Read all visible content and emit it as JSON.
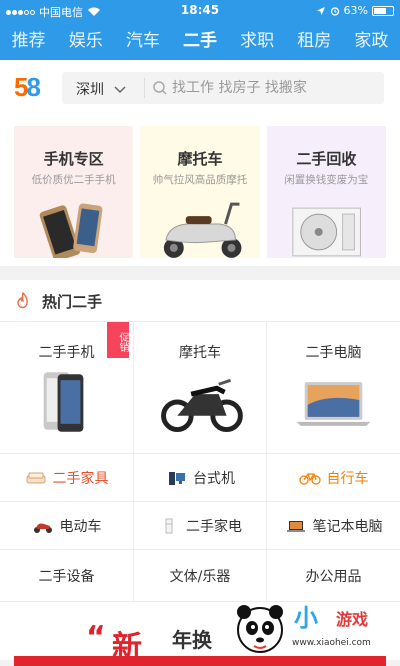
{
  "status_bar": {
    "carrier": "中国电信",
    "time": "18:45",
    "battery": "63%"
  },
  "tabs": [
    "推荐",
    "娱乐",
    "汽车",
    "二手",
    "求职",
    "租房",
    "家政"
  ],
  "active_tab": 3,
  "logo": [
    "5",
    "8"
  ],
  "search": {
    "city": "深圳",
    "placeholder": "找工作 找房子 找搬家"
  },
  "promos": [
    {
      "title": "手机专区",
      "subtitle": "低价质优二手手机",
      "bg": "#fdeeee",
      "icon": "phone-image"
    },
    {
      "title": "摩托车",
      "subtitle": "帅气拉风高品质摩托",
      "bg": "#fffbe6",
      "icon": "scooter-image"
    },
    {
      "title": "二手回收",
      "subtitle": "闲置换钱变废为宝",
      "bg": "#f6eefb",
      "icon": "air-conditioner-image"
    }
  ],
  "hot": {
    "title": "热门二手",
    "featured": [
      {
        "label": "二手手机",
        "badge": "促销",
        "icon": "iphone-image"
      },
      {
        "label": "摩托车",
        "badge": "",
        "icon": "motorcycle-image"
      },
      {
        "label": "二手电脑",
        "badge": "",
        "icon": "laptop-image"
      }
    ],
    "row2": [
      {
        "label": "二手家具",
        "icon": "sofa-icon",
        "color": "#e8532d"
      },
      {
        "label": "台式机",
        "icon": "desktop-icon",
        "color": "#333333"
      },
      {
        "label": "自行车",
        "icon": "bicycle-icon",
        "color": "#ff7e00"
      }
    ],
    "row3": [
      {
        "label": "电动车",
        "icon": "e-scooter-icon"
      },
      {
        "label": "二手家电",
        "icon": "fridge-icon"
      },
      {
        "label": "笔记本电脑",
        "icon": "notebook-icon"
      }
    ],
    "row4": [
      "二手设备",
      "文体/乐器",
      "办公用品"
    ]
  },
  "banner": {
    "quote": "“",
    "big": "新",
    "text": "年换"
  },
  "watermark": {
    "brand1": "小",
    "brand2": "游戏",
    "url": "www.xiaohei.com"
  }
}
